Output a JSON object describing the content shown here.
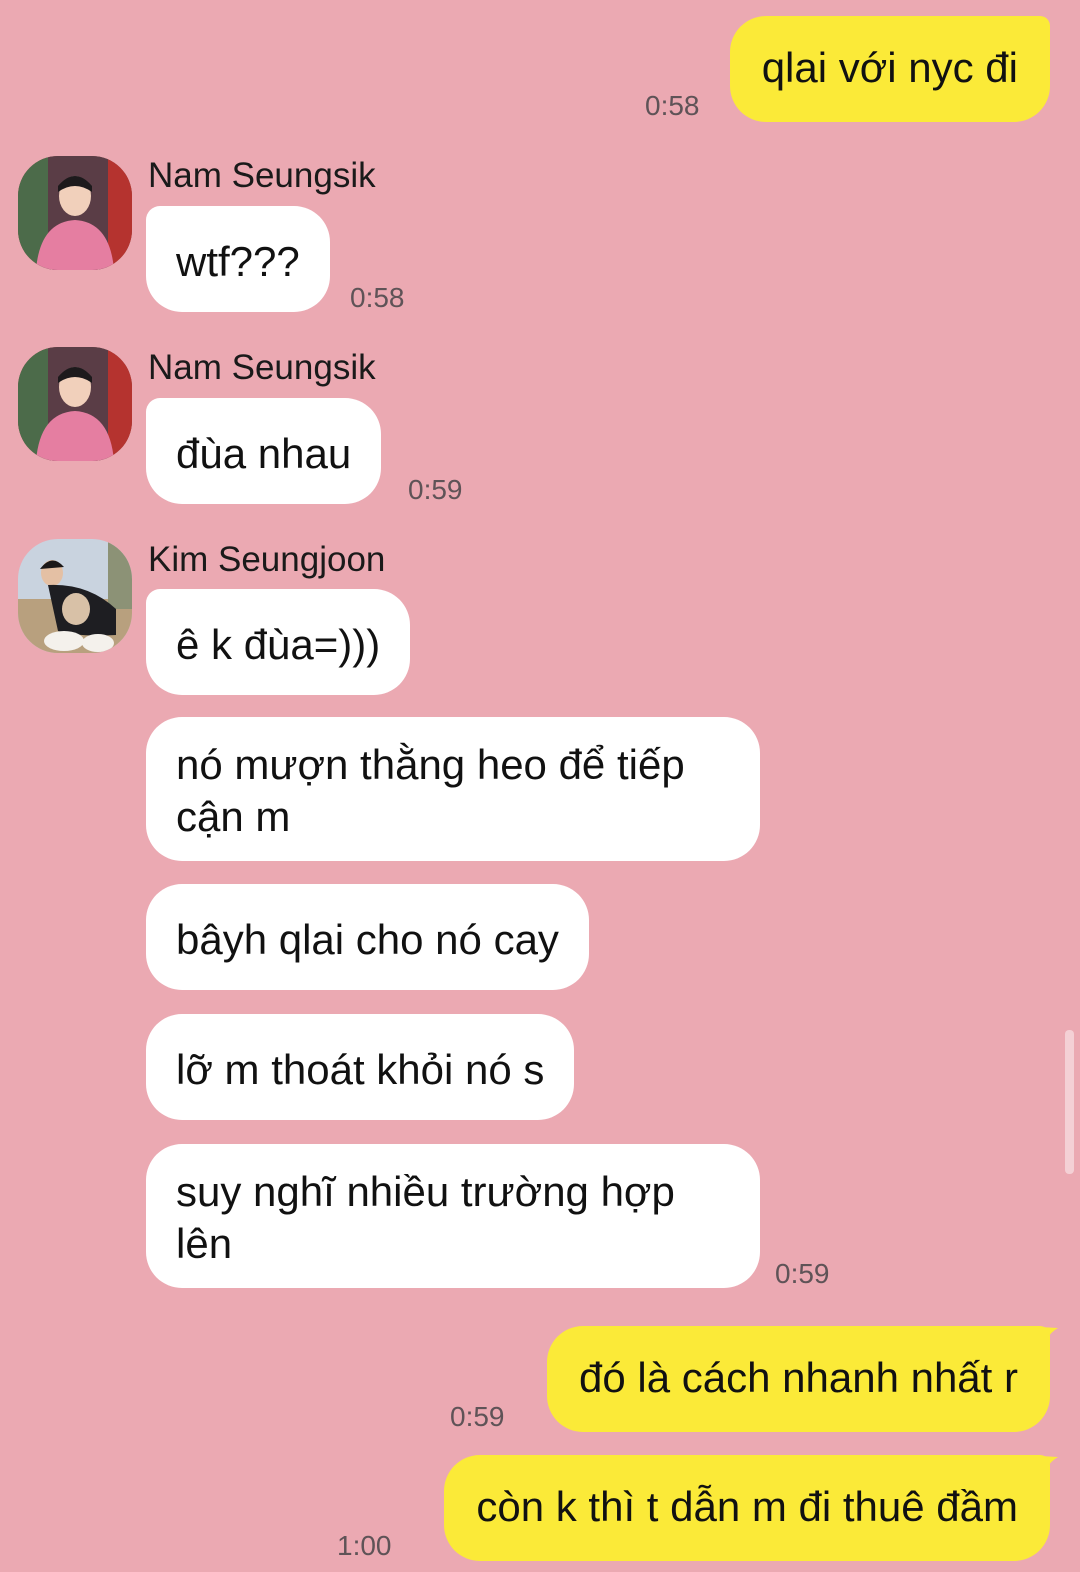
{
  "theme": {
    "background": "#EBA9B2",
    "outgoing_bubble": "#FBEA38",
    "incoming_bubble": "#FFFFFF"
  },
  "messages": [
    {
      "direction": "outgoing",
      "text": "qlai với nyc đi",
      "time": "0:58"
    },
    {
      "direction": "incoming",
      "sender": "Nam Seungsik",
      "avatar": "avatar-nam-seungsik",
      "text": "wtf???",
      "time": "0:58"
    },
    {
      "direction": "incoming",
      "sender": "Nam Seungsik",
      "avatar": "avatar-nam-seungsik",
      "text": "đùa nhau",
      "time": "0:59"
    },
    {
      "direction": "incoming",
      "sender": "Kim Seungjoon",
      "avatar": "avatar-kim-seungjoon",
      "text": "ê k đùa=)))"
    },
    {
      "direction": "incoming",
      "text": "nó mượn thằng heo để tiếp cận m"
    },
    {
      "direction": "incoming",
      "text": "bâyh qlai cho nó cay"
    },
    {
      "direction": "incoming",
      "text": "lỡ m thoát khỏi nó s"
    },
    {
      "direction": "incoming",
      "text": "suy nghĩ nhiều trường hợp lên",
      "time": "0:59"
    },
    {
      "direction": "outgoing",
      "text": "đó là cách nhanh nhất r",
      "time": "0:59"
    },
    {
      "direction": "outgoing",
      "text": "còn k thì t dẫn m đi thuê đầm",
      "time": "1:00"
    }
  ]
}
